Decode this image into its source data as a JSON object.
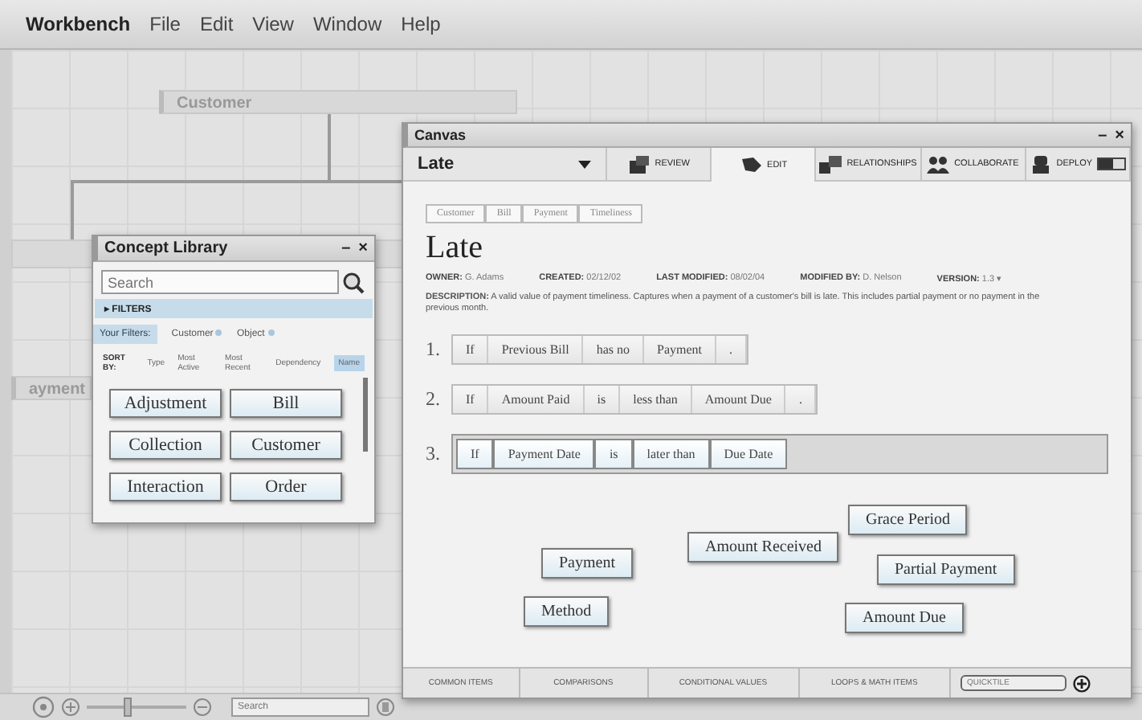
{
  "menu_bar": {
    "app_name": "Workbench",
    "items": [
      "File",
      "Edit",
      "View",
      "Window",
      "Help"
    ]
  },
  "window_controls": {
    "minimize": "–",
    "close": "×"
  },
  "diagram": {
    "nodes": [
      {
        "label": "Customer"
      },
      {
        "label": "ayment"
      }
    ]
  },
  "concept_library": {
    "title": "Concept Library",
    "search": {
      "placeholder": "Search"
    },
    "filters_label": "FILTERS",
    "filters_arrow": "▸",
    "your_filters_label": "Your Filters:",
    "filters": [
      "Customer",
      "Object"
    ],
    "sort_label": "SORT BY:",
    "sort_options": [
      {
        "label": "Type",
        "selected": false
      },
      {
        "label": "Most Active",
        "selected": false
      },
      {
        "label": "Most Recent",
        "selected": false
      },
      {
        "label": "Dependency",
        "selected": false
      },
      {
        "label": "Name",
        "selected": true
      }
    ],
    "tiles": [
      "Adjustment",
      "Bill",
      "Collection",
      "Customer",
      "Interaction",
      "Order"
    ]
  },
  "canvas": {
    "title": "Canvas",
    "concept_dropdown": "Late",
    "tabs": [
      {
        "label": "REVIEW",
        "kind": "review",
        "selected": false
      },
      {
        "label": "EDIT",
        "kind": "edit",
        "selected": true
      },
      {
        "label": "RELATIONSHIPS",
        "kind": "relationships",
        "selected": false
      },
      {
        "label": "COLLABORATE",
        "kind": "collaborate",
        "selected": false
      },
      {
        "label": "DEPLOY",
        "kind": "deploy",
        "selected": false
      }
    ],
    "deploy_toggle": {
      "on": false
    },
    "breadcrumb": [
      "Customer",
      "Bill",
      "Payment",
      "Timeliness"
    ],
    "heading": "Late",
    "meta": [
      {
        "label": "OWNER:",
        "value": "G. Adams"
      },
      {
        "label": "CREATED:",
        "value": "02/12/02"
      },
      {
        "label": "LAST MODIFIED:",
        "value": "08/02/04"
      },
      {
        "label": "MODIFIED BY:",
        "value": "D. Nelson"
      },
      {
        "label": "VERSION:",
        "value": "1.3 ▾"
      }
    ],
    "description": "**DESCRIPTION:** A valid value of payment timeliness. Captures when a payment of a customer's bill is late. This includes partial payment or no payment in the previous month.",
    "rules": [
      {
        "number": "1.",
        "selected": false,
        "tokens": [
          "If",
          "Previous Bill",
          "has no",
          "Payment",
          "."
        ]
      },
      {
        "number": "2.",
        "selected": false,
        "tokens": [
          "If",
          "Amount Paid",
          "is",
          "less than",
          "Amount Due",
          "."
        ]
      },
      {
        "number": "3.",
        "selected": true,
        "tokens": [
          "If",
          "Payment Date",
          "is",
          "later than",
          "Due Date"
        ]
      }
    ],
    "free_tiles": [
      "Grace Period",
      "Amount Received",
      "Payment",
      "Partial Payment",
      "Method",
      "Amount Due"
    ],
    "bottom_tabs": [
      "COMMON ITEMS",
      "COMPARISONS",
      "CONDITIONAL VALUES",
      "LOOPS & MATH ITEMS"
    ],
    "quicktile": {
      "placeholder": "QUICKTILE"
    }
  },
  "status_bar": {
    "zoom": {
      "level": 0.4
    },
    "search": {
      "placeholder": "Search"
    }
  }
}
